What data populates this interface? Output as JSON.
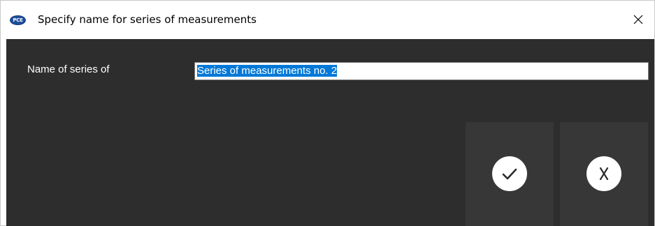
{
  "window": {
    "title": "Specify name for series of measurements",
    "app_icon_text": "PCE",
    "app_icon": "pce-logo-icon",
    "close_icon": "close-icon"
  },
  "form": {
    "label": "Name of series of",
    "input_value": "Series of measurements no. 2",
    "input_selected": true
  },
  "buttons": {
    "ok_icon": "checkmark-icon",
    "cancel_icon": "x-icon"
  },
  "colors": {
    "content_background": "#2d2d2d",
    "button_background": "#373737",
    "selection_highlight": "#0078d7",
    "icon_circle": "#ffffff"
  }
}
